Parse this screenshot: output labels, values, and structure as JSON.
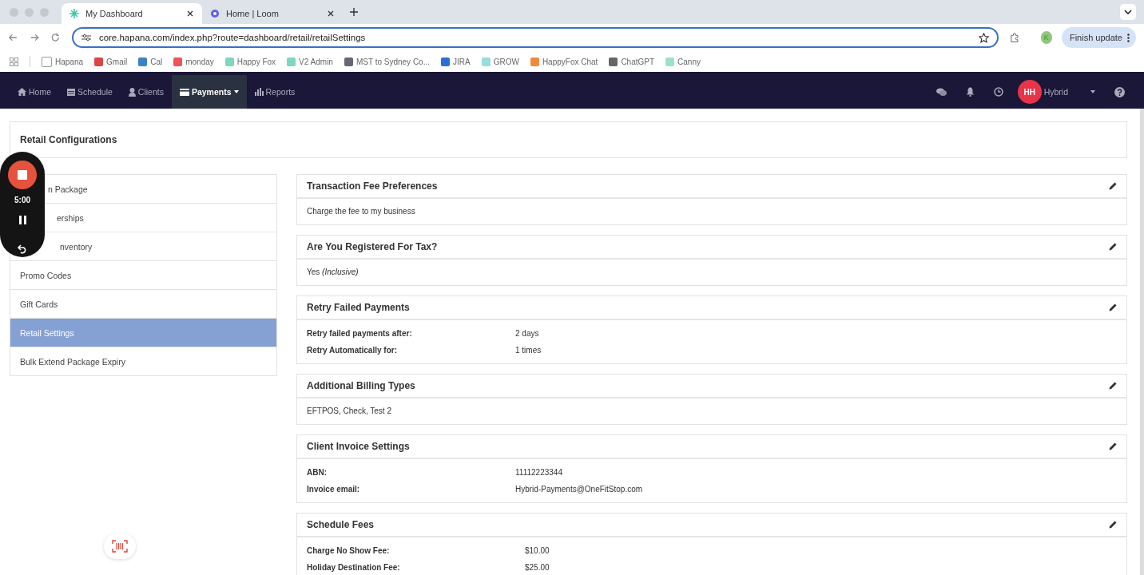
{
  "browser": {
    "tabs": [
      {
        "title": "My Dashboard",
        "selected": true
      },
      {
        "title": "Home | Loom",
        "selected": false
      }
    ],
    "url": "core.hapana.com/index.php?route=dashboard/retail/retailSettings",
    "bookmarks": [
      "Hapana",
      "Gmail",
      "Cal",
      "monday",
      "Happy Fox",
      "V2 Admin",
      "MST to Sydney Co...",
      "JIRA",
      "GROW",
      "HappyFox Chat",
      "ChatGPT",
      "Canny"
    ],
    "profile_initial": "K",
    "update_button": "Finish update"
  },
  "nav": {
    "items": [
      {
        "label": "Home",
        "selected": false
      },
      {
        "label": "Schedule",
        "selected": false
      },
      {
        "label": "Clients",
        "selected": false
      },
      {
        "label": "Payments",
        "selected": true
      },
      {
        "label": "Reports",
        "selected": false
      }
    ],
    "user": {
      "initials": "HH",
      "name": "Hybrid"
    }
  },
  "page_title": "Retail Configurations",
  "sidebar": {
    "items": [
      {
        "label": "n Package",
        "selected": false
      },
      {
        "label": "erships",
        "selected": false
      },
      {
        "label": "nventory",
        "selected": false
      },
      {
        "label": "Promo Codes",
        "selected": false
      },
      {
        "label": "Gift Cards",
        "selected": false
      },
      {
        "label": "Retail Settings",
        "selected": true
      },
      {
        "label": "Bulk Extend Package Expiry",
        "selected": false
      }
    ]
  },
  "panels": [
    {
      "title": "Transaction Fee Preferences",
      "kind": "text",
      "text": "Charge the fee to my business"
    },
    {
      "title": "Are You Registered For Tax?",
      "kind": "text",
      "text": "Yes *(Inclusive)*"
    },
    {
      "title": "Retry Failed Payments",
      "kind": "fields",
      "fields": [
        {
          "label": "Retry failed payments after:",
          "value": "2 days"
        },
        {
          "label": "Retry Automatically for:",
          "value": "1 times"
        }
      ]
    },
    {
      "title": "Additional Billing Types",
      "kind": "text",
      "text": "EFTPOS, Check, Test 2"
    },
    {
      "title": "Client Invoice Settings",
      "kind": "fields",
      "fields": [
        {
          "label": "ABN:",
          "value": "11112223344"
        },
        {
          "label": "Invoice email:",
          "value": "Hybrid-Payments@OneFitStop.com"
        }
      ]
    },
    {
      "title": "Schedule Fees",
      "kind": "fields",
      "fields": [
        {
          "label": "Charge No Show Fee:",
          "value": "$10.00"
        },
        {
          "label": "Holiday Destination Fee:",
          "value": "$25.00"
        }
      ]
    }
  ],
  "recorder": {
    "time": "5:00"
  }
}
